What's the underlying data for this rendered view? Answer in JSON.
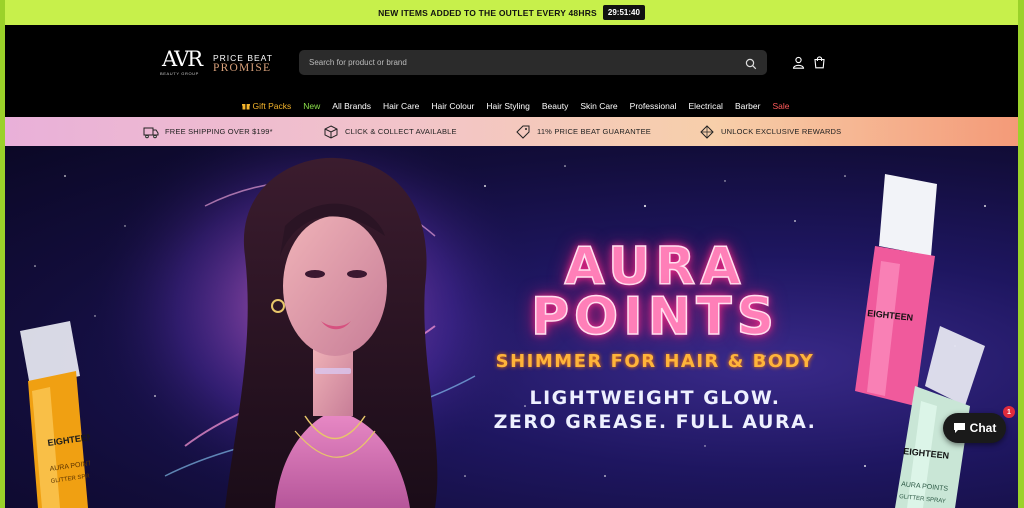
{
  "announcement": {
    "text": "NEW ITEMS ADDED TO THE OUTLET EVERY 48HRS",
    "timer": "29:51:40"
  },
  "logo": {
    "mark": "AVR",
    "sub": "BEAUTY GROUP",
    "tag_line1": "PRICE BEAT",
    "tag_line2": "PROMISE"
  },
  "search": {
    "placeholder": "Search for product or brand"
  },
  "nav": {
    "items": [
      {
        "label": "Gift Packs"
      },
      {
        "label": "New"
      },
      {
        "label": "All Brands"
      },
      {
        "label": "Hair Care"
      },
      {
        "label": "Hair Colour"
      },
      {
        "label": "Hair Styling"
      },
      {
        "label": "Beauty"
      },
      {
        "label": "Skin Care"
      },
      {
        "label": "Professional"
      },
      {
        "label": "Electrical"
      },
      {
        "label": "Barber"
      },
      {
        "label": "Sale"
      }
    ]
  },
  "usp": {
    "items": [
      {
        "label": "FREE SHIPPING OVER $199*",
        "icon": "truck-icon"
      },
      {
        "label": "CLICK & COLLECT AVAILABLE",
        "icon": "box-icon"
      },
      {
        "label": "11% PRICE BEAT GUARANTEE",
        "icon": "tag-icon"
      },
      {
        "label": "UNLOCK EXCLUSIVE REWARDS",
        "icon": "diamond-icon"
      }
    ]
  },
  "hero": {
    "line1": "AURA",
    "line2": "POINTS",
    "subtitle": "SHIMMER FOR HAIR & BODY",
    "tagline1": "LIGHTWEIGHT GLOW.",
    "tagline2": "ZERO GREASE. FULL AURA.",
    "bottle_brand": "EIGHTEEN",
    "bottle_product": "AURA POINTS",
    "bottle_sub": "GLITTER SPRAY"
  },
  "chat": {
    "label": "Chat",
    "badge": "1"
  },
  "colors": {
    "announce_bg": "#c7f04b",
    "accent_pink": "#ff7fb8",
    "accent_orange": "#ffb43a",
    "sale": "#ff5a5a",
    "new": "#8be04a",
    "gift": "#f4b42b"
  }
}
